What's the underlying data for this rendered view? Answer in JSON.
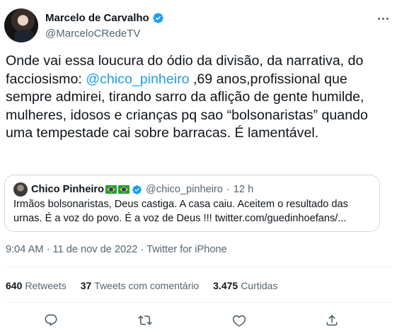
{
  "author": {
    "name": "Marcelo de Carvalho",
    "handle": "@MarceloCRedeTV"
  },
  "tweet": {
    "text_1": "Onde vai essa loucura do ódio da divisão, da narrativa, do facciosismo: ",
    "mention": "@chico_pinheiro",
    "text_2": " ,69 anos,profissional que sempre admirei, tirando sarro da aflição de gente humilde, mulheres, idosos e crianças pq sao “bolsonaristas” quando uma tempestade cai sobre barracas. É lamentável."
  },
  "quoted_tweet": {
    "name": "Chico Pinheiro",
    "handle": "@chico_pinheiro",
    "separator": "·",
    "time": "12 h",
    "text": "Irmãos bolsonaristas, Deus castiga. A casa caiu. Aceitem  o resultado das urnas. É a voz do povo. É a voz de Deus !!! twitter.com/guedinhoefans/..."
  },
  "meta": {
    "time": "9:04 AM",
    "separator": "·",
    "date": "11 de nov de 2022",
    "via": "Twitter for iPhone"
  },
  "stats": {
    "retweets_count": "640",
    "retweets_label": "Retweets",
    "quotes_count": "37",
    "quotes_label": "Tweets com comentário",
    "likes_count": "3.475",
    "likes_label": "Curtidas"
  },
  "icons": {
    "verified": "verified-badge-icon",
    "more": "more-dots-icon",
    "reply": "reply-bubble-icon",
    "retweet": "retweet-icon",
    "like": "heart-icon",
    "share": "share-icon"
  },
  "colors": {
    "accent": "#1d9bf0",
    "text": "#0f1419",
    "muted": "#536471",
    "border": "#cfd9de"
  }
}
